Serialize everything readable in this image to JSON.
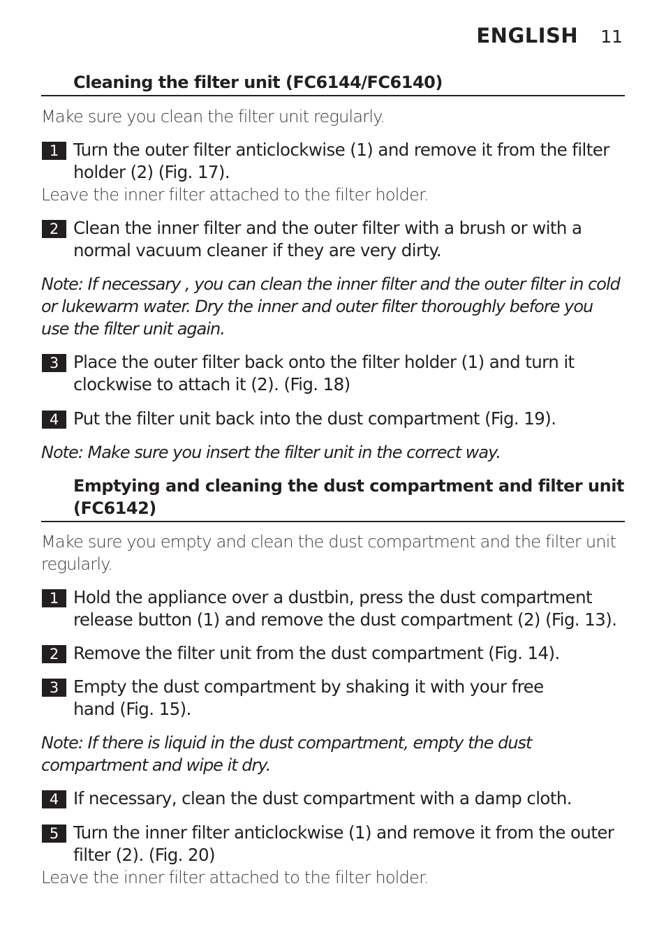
{
  "header": {
    "language": "ENGLISH",
    "page_number": "11"
  },
  "section1": {
    "title": "Cleaning the filter unit (FC6144/FC6140)",
    "intro": "Make sure you clean the filter unit regularly.",
    "steps": [
      {
        "num": "1",
        "text": "Turn the outer filter anticlockwise (1) and remove it from the filter holder (2) (Fig. 17)."
      },
      {
        "num": "2",
        "text": "Clean the inner filter and the outer filter with a brush or with a normal vacuum cleaner if they are very dirty."
      },
      {
        "num": "3",
        "text": "Place the outer filter back onto the filter holder (1) and turn it clockwise to attach it (2).  (Fig. 18)"
      },
      {
        "num": "4",
        "text": "Put the filter unit back into the dust compartment (Fig. 19)."
      }
    ],
    "after_step1": "Leave the inner filter attached to the filter holder.",
    "note1": "Note: If necessary , you can clean the inner filter and the outer filter in cold or lukewarm water. Dry the inner and outer filter thoroughly before you use the filter unit again.",
    "note2": "Note: Make sure you insert the filter unit in the correct way."
  },
  "section2": {
    "title": "Emptying and cleaning the dust compartment and filter unit (FC6142)",
    "intro": "Make sure you empty and clean the dust compartment and the filter unit regularly.",
    "steps": [
      {
        "num": "1",
        "text": "Hold the appliance over a dustbin, press the dust compartment release button (1) and remove the dust compartment (2) (Fig. 13)."
      },
      {
        "num": "2",
        "text": "Remove the filter unit from the dust compartment (Fig. 14)."
      },
      {
        "num": "3",
        "text": "Empty the dust compartment by shaking it with your free hand (Fig. 15)."
      },
      {
        "num": "4",
        "text": "If necessary, clean the dust compartment with a damp cloth."
      },
      {
        "num": "5",
        "text": "Turn the inner filter anticlockwise (1) and remove it from the outer filter (2).  (Fig. 20)"
      }
    ],
    "note1": "Note: If there is liquid in the dust compartment, empty the dust compartment and wipe it dry.",
    "after_step5": "Leave the inner filter attached to the filter holder."
  }
}
